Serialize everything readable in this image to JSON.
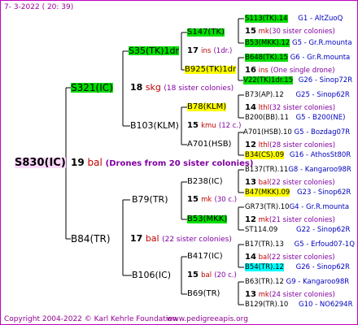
{
  "header": {
    "date": "7-  3-2022 ( 20: 39)"
  },
  "footer": {
    "copyright": "Copyright 2004-2022 © Karl Kehrle Foundation",
    "site": "www.pedigreeapis.org"
  },
  "root": {
    "name": "S830(IC)",
    "num": "19",
    "code": "bal",
    "note": "(Drones from 20 sister colonies)"
  },
  "g1": [
    {
      "name": "S321(IC)",
      "num": "18",
      "code": "skg",
      "note": "(18 sister colonies)"
    },
    {
      "name": "B84(TR)",
      "num": "17",
      "code": "bal",
      "note": "(22 sister colonies)"
    }
  ],
  "g2": [
    {
      "name": "S35(TK)1dr",
      "num": "17",
      "code": "ins",
      "note": "(1dr.)"
    },
    {
      "name": "B103(KLM)",
      "num": "15",
      "code": "kmu",
      "note": "(12 c.)"
    },
    {
      "name": "B79(TR)",
      "num": "15",
      "code": "mk",
      "note": "(30 c.)"
    },
    {
      "name": "B106(IC)",
      "num": "15",
      "code": "bal",
      "note": "(20 c.)"
    }
  ],
  "g3": [
    {
      "name": "S147(TK)"
    },
    {
      "name": "B925(TK)1dr"
    },
    {
      "name": "B78(KLM)"
    },
    {
      "name": "A701(HSB)"
    },
    {
      "name": "B238(IC)"
    },
    {
      "name": "B53(MKK)"
    },
    {
      "name": "B417(IC)"
    },
    {
      "name": "B69(TR)"
    }
  ],
  "g4": [
    {
      "name": "S113(TK).14",
      "origin": "G1 - AltZuoQ",
      "num": "15",
      "code": "mk",
      "note": "(30 sister colonies)"
    },
    {
      "name": "B53(MKK).12",
      "origin": "G5 - Gr.R.mounta"
    },
    {
      "name": "B648(TK).15",
      "origin": "G6 - Gr.R.mounta",
      "num": "16",
      "code": "ins",
      "note": "(One single drone)"
    },
    {
      "name": "V22(TK)1dr.15",
      "origin": "G26 - Sinop72R"
    },
    {
      "name": "B73(AP).12",
      "origin": "G25 - Sinop62R",
      "num": "14",
      "code": "lthl",
      "note": "(32 sister colonies)"
    },
    {
      "name": "B200(BB).11",
      "origin": "G5 - B200(NE)"
    },
    {
      "name": "A701(HSB).10",
      "origin": "G5 - Bozdag07R",
      "num": "12",
      "code": "lthl",
      "note": "(28 sister colonies)"
    },
    {
      "name": "B34(CS).09",
      "origin": "G16 - AthosSt80R"
    },
    {
      "name": "B137(TR).11",
      "origin": "G8 - Kangaroo98R",
      "num": "13",
      "code": "bal",
      "note": "(22 sister colonies)"
    },
    {
      "name": "B47(MKK).09",
      "origin": "G23 - Sinop62R"
    },
    {
      "name": "GR73(TR).10",
      "origin": "G4 - Gr.R.mounta",
      "num": "12",
      "code": "mk",
      "note": "(21 sister colonies)"
    },
    {
      "name": "ST114.09",
      "origin": "G22 - Sinop62R"
    },
    {
      "name": "B17(TR).13",
      "origin": "G5 - Erfoud07-1Q",
      "num": "14",
      "code": "bal",
      "note": "(22 sister colonies)"
    },
    {
      "name": "B54(TR).12",
      "origin": "G26 - Sinop62R"
    },
    {
      "name": "B63(TR).12",
      "origin": "G9 - Kangaroo98R",
      "num": "13",
      "code": "mk",
      "note": "(24 sister colonies)"
    },
    {
      "name": "B129(TR).10",
      "origin": "G10 - NO6294R"
    }
  ]
}
